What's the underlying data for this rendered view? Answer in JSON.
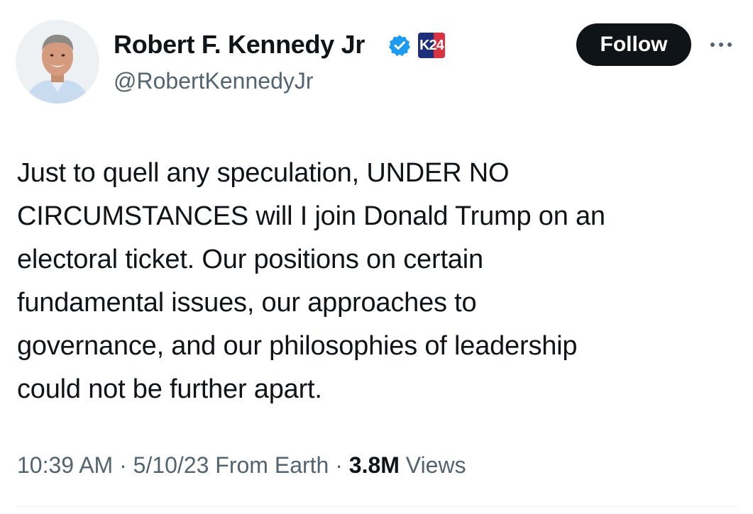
{
  "account": {
    "display_name": "Robert F. Kennedy Jr",
    "handle": "@RobertKennedyJr",
    "verified_icon": "verified-badge-icon",
    "affiliate_badge_text": "K24",
    "affiliate_colors": [
      "#1d2f7a",
      "#d93240"
    ]
  },
  "actions": {
    "follow_label": "Follow",
    "more_icon": "more-options-icon"
  },
  "tweet": {
    "text": "Just to quell any speculation, UNDER NO\nCIRCUMSTANCES will I join Donald Trump on an\nelectoral ticket. Our positions on certain\nfundamental issues, our approaches to\ngovernance, and our philosophies of leadership\ncould not be further apart."
  },
  "meta": {
    "time": "10:39 AM",
    "sep1": "·",
    "date": "5/10/23",
    "source": "From Earth",
    "sep2": "·",
    "views_count": "3.8M",
    "views_label": "Views"
  },
  "colors": {
    "text_primary": "#0f1419",
    "text_secondary": "#536471",
    "verified_blue": "#1d9bf0",
    "button_bg": "#0f1419"
  }
}
